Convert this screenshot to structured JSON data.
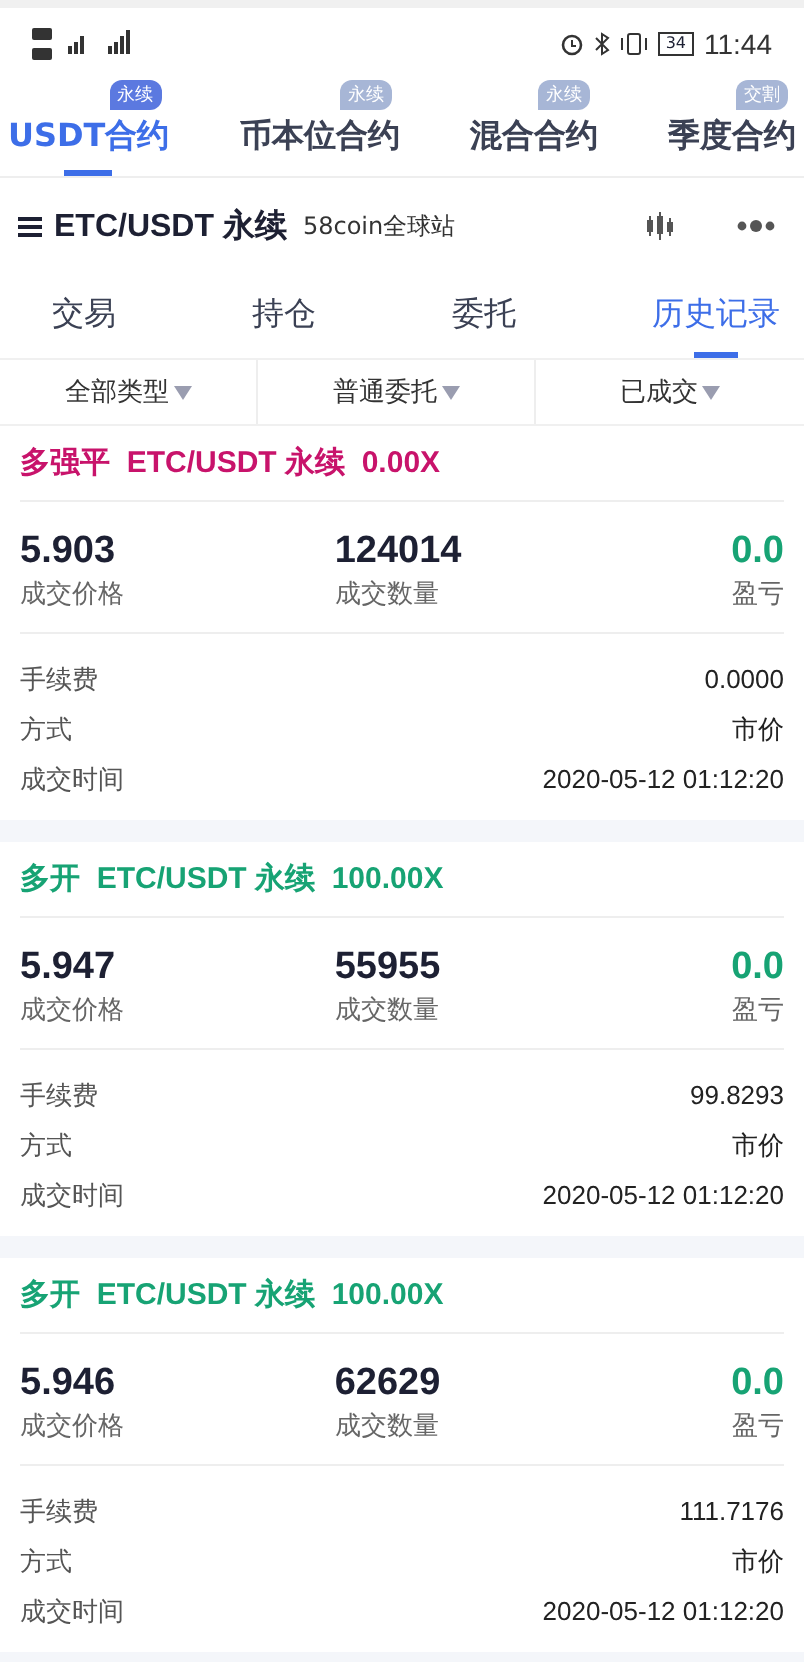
{
  "status_bar": {
    "time": "11:44",
    "battery": "34"
  },
  "contract_tabs": [
    {
      "label": "USDT合约",
      "badge": "永续",
      "selected": true
    },
    {
      "label": "币本位合约",
      "badge": "永续",
      "selected": false
    },
    {
      "label": "混合合约",
      "badge": "永续",
      "selected": false
    },
    {
      "label": "季度合约",
      "badge": "交割",
      "selected": false
    }
  ],
  "header": {
    "pair": "ETC/USDT 永续",
    "exchange": "58coin全球站"
  },
  "sub_tabs": [
    {
      "label": "交易",
      "selected": false
    },
    {
      "label": "持仓",
      "selected": false
    },
    {
      "label": "委托",
      "selected": false
    },
    {
      "label": "历史记录",
      "selected": true
    }
  ],
  "filters": [
    "全部类型",
    "普通委托",
    "已成交"
  ],
  "records": [
    {
      "title": "多强平  ETC/USDT 永续  0.00X",
      "color": "#c8136b",
      "price": "5.903",
      "price_label": "成交价格",
      "amount": "124014",
      "amount_label": "成交数量",
      "pnl": "0.0",
      "pnl_label": "盈亏",
      "details": [
        {
          "label": "手续费",
          "value": "0.0000"
        },
        {
          "label": "方式",
          "value": "市价"
        },
        {
          "label": "成交时间",
          "value": "2020-05-12 01:12:20"
        }
      ]
    },
    {
      "title": "多开  ETC/USDT 永续  100.00X",
      "color": "#17a374",
      "price": "5.947",
      "price_label": "成交价格",
      "amount": "55955",
      "amount_label": "成交数量",
      "pnl": "0.0",
      "pnl_label": "盈亏",
      "details": [
        {
          "label": "手续费",
          "value": "99.8293"
        },
        {
          "label": "方式",
          "value": "市价"
        },
        {
          "label": "成交时间",
          "value": "2020-05-12 01:12:20"
        }
      ]
    },
    {
      "title": "多开  ETC/USDT 永续  100.00X",
      "color": "#17a374",
      "price": "5.946",
      "price_label": "成交价格",
      "amount": "62629",
      "amount_label": "成交数量",
      "pnl": "0.0",
      "pnl_label": "盈亏",
      "details": [
        {
          "label": "手续费",
          "value": "111.7176"
        },
        {
          "label": "方式",
          "value": "市价"
        },
        {
          "label": "成交时间",
          "value": "2020-05-12 01:12:20"
        }
      ]
    }
  ]
}
